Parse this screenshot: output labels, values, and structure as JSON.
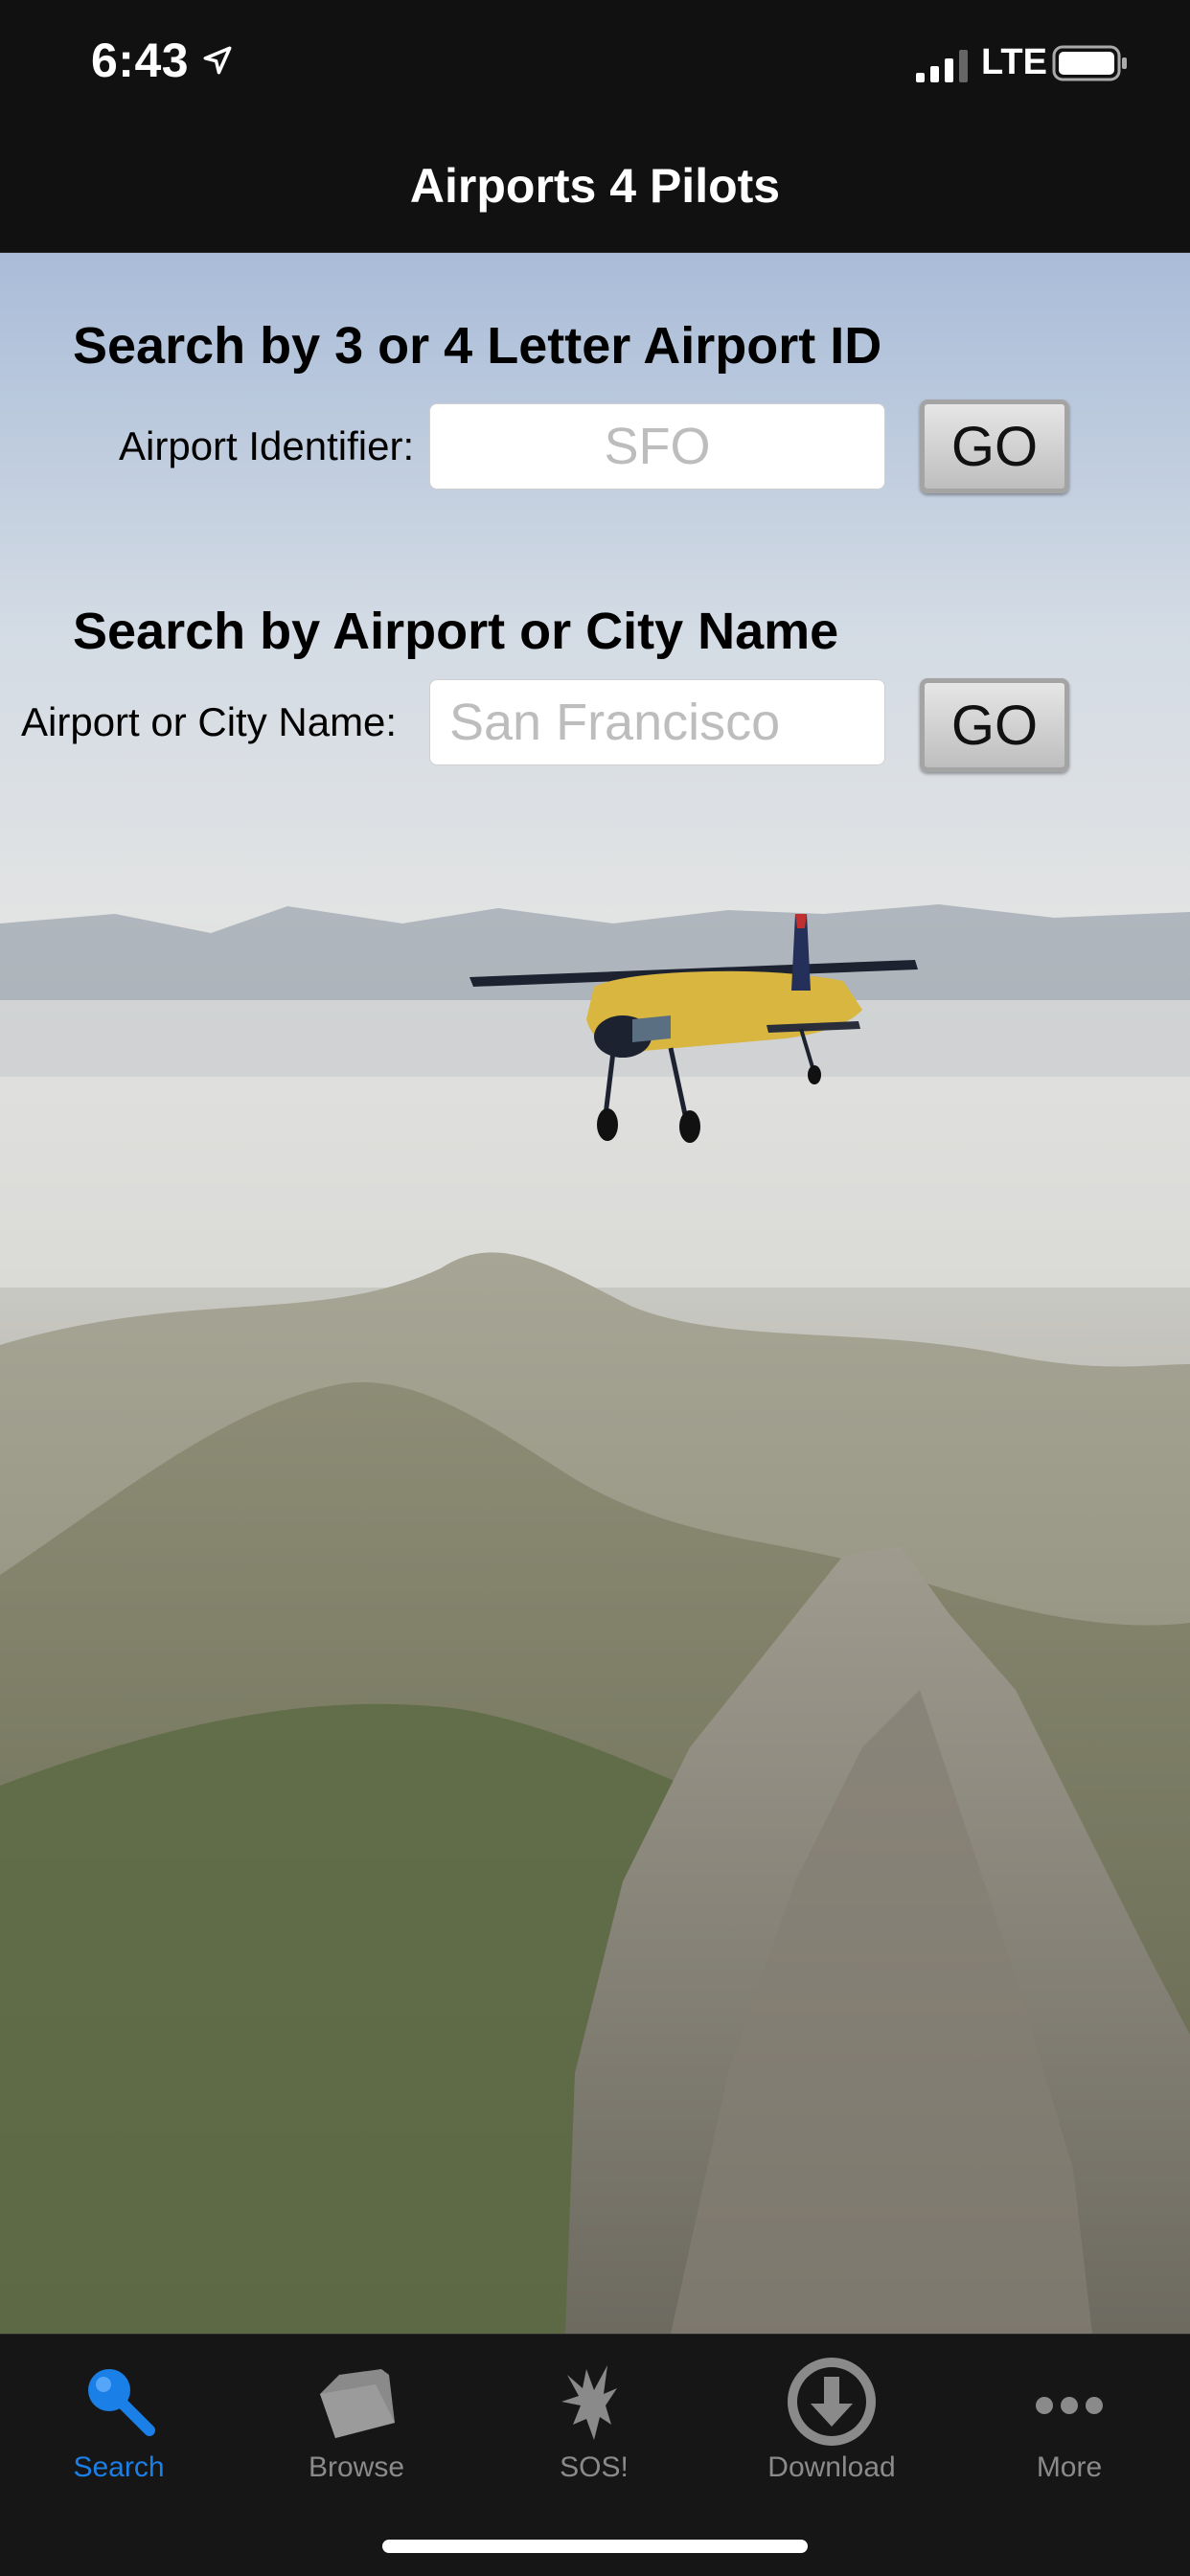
{
  "status_bar": {
    "time": "6:43",
    "network": "LTE"
  },
  "nav": {
    "title": "Airports 4 Pilots"
  },
  "search_id": {
    "title": "Search by 3 or 4 Letter Airport ID",
    "label": "Airport Identifier:",
    "placeholder": "SFO",
    "value": "",
    "go_label": "GO"
  },
  "search_name": {
    "title": "Search by Airport or City Name",
    "label": "Airport or City Name:",
    "placeholder": "San Francisco",
    "value": "",
    "go_label": "GO"
  },
  "tabs": [
    {
      "label": "Search",
      "icon": "magnifier-icon",
      "active": true
    },
    {
      "label": "Browse",
      "icon": "folder-icon",
      "active": false
    },
    {
      "label": "SOS!",
      "icon": "eagle-icon",
      "active": false
    },
    {
      "label": "Download",
      "icon": "download-icon",
      "active": false
    },
    {
      "label": "More",
      "icon": "more-dots-icon",
      "active": false
    }
  ],
  "colors": {
    "accent": "#1a7fe6",
    "inactive": "#8a8a8a",
    "bar": "#161616"
  }
}
